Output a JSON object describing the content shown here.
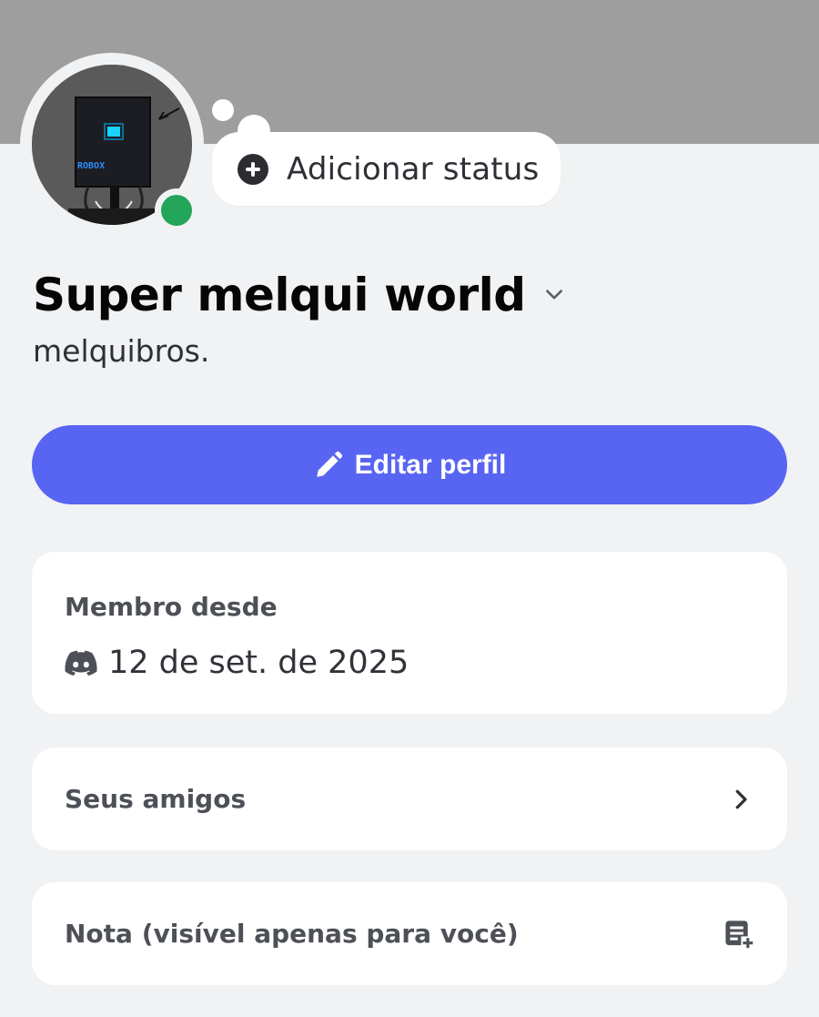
{
  "header": {
    "banner_color": "#9e9e9e"
  },
  "profile": {
    "avatar_text": "ROBOX",
    "presence": "online",
    "presence_color": "#23a55a",
    "status_button_label": "Adicionar status",
    "display_name": "Super melqui world",
    "username": "melquibros."
  },
  "actions": {
    "edit_profile_label": "Editar perfil",
    "accent_color": "#5865f2"
  },
  "member_since": {
    "title": "Membro desde",
    "icon": "discord-icon",
    "date": "12 de set. de 2025"
  },
  "rows": {
    "friends_label": "Seus amigos",
    "friends_icon": "chevron-right-icon",
    "note_label": "Nota (visível apenas para você)",
    "note_icon": "note-add-icon"
  }
}
